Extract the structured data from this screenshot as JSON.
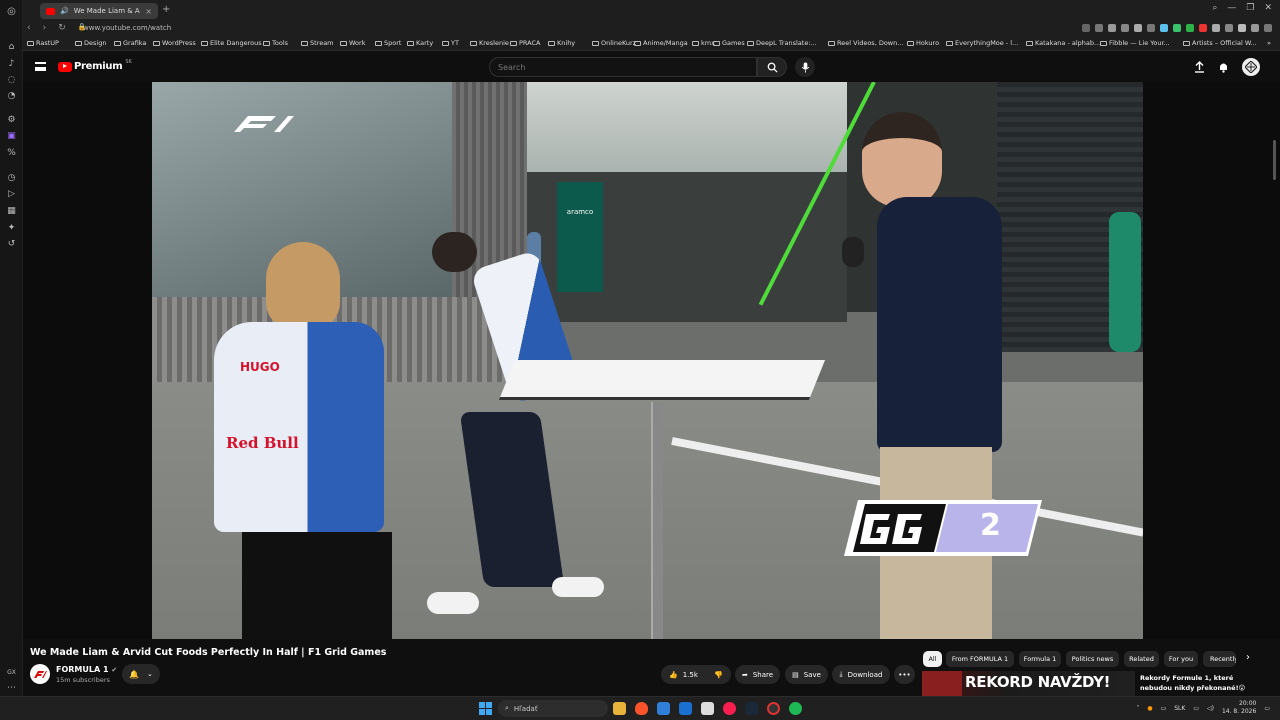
{
  "browser": {
    "tab_title": "We Made Liam & Arvid",
    "url": "www.youtube.com/watch",
    "bookmarks": [
      "RastUP",
      "Design",
      "Grafika",
      "WordPress",
      "Elite Dangerous",
      "Tools",
      "Stream",
      "Work",
      "Sport",
      "Karty",
      "YT",
      "Kreslenie",
      "PRACA",
      "Knihy",
      "OnlineKurz",
      "Anime/Manga",
      "kmx",
      "Games",
      "DeepL Translate:...",
      "Reel Videos, Down...",
      "Hokuro",
      "EverythingMoe - l...",
      "Katakana - alphab...",
      "Fibble — Lie Your...",
      "Artists – Official W..."
    ]
  },
  "youtube": {
    "logo_text": "Premium",
    "logo_sup": "SK",
    "search_placeholder": "Search",
    "video": {
      "overlay_badge": "2",
      "jersey_name": "HUGO",
      "jersey_sponsor": "Red Bull",
      "booth_sign": "aramco"
    },
    "title": "We Made Liam & Arvid Cut Foods Perfectly In Half | F1 Grid Games",
    "channel": {
      "name": "FORMULA 1",
      "subscribers": "15m subscribers"
    },
    "actions": {
      "likes": "1.5k",
      "share": "Share",
      "save": "Save",
      "download": "Download",
      "more": "•••"
    },
    "chips": [
      "All",
      "From FORMULA 1",
      "Formula 1",
      "Politics news",
      "Related",
      "For you",
      "Recently"
    ],
    "recommended": {
      "thumb_text": "REKORD NAVŽDY!",
      "title": "Rekordy Formule 1, které nebudou nikdy překonané!😮"
    }
  },
  "taskbar": {
    "search_label": "Hľadať",
    "language": "SLK",
    "time": "20:00",
    "date": "14. 8. 2026"
  },
  "left_strip": {
    "gx_label": "GX"
  },
  "colors": {
    "youtube_red": "#ff0000",
    "bg": "#0f0f0f",
    "chip_bg": "#272727",
    "gg_purple": "#b9b4ea"
  }
}
